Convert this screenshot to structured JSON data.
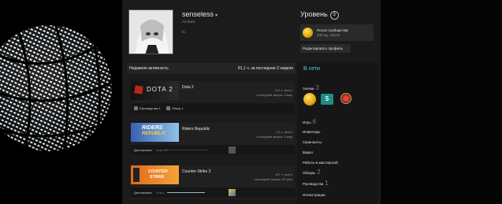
{
  "profile": {
    "name": "senseless",
    "status": "I'm tired",
    "summary": "fo."
  },
  "level": {
    "title": "Уровень",
    "value": "3"
  },
  "badge": {
    "name": "Посол сообщества",
    "xp": "200 ед. опыта"
  },
  "edit_profile": "Редактировать профиль",
  "online": "В сети",
  "right_links": [
    {
      "label": "Значки",
      "count": "3"
    },
    {
      "label": "Игры",
      "count": "6"
    },
    {
      "label": "Инвентарь",
      "count": ""
    },
    {
      "label": "Скриншоты",
      "count": ""
    },
    {
      "label": "Видео",
      "count": ""
    },
    {
      "label": "Работы в мастерской",
      "count": ""
    },
    {
      "label": "Обзоры",
      "count": "2"
    },
    {
      "label": "Руководства",
      "count": "1"
    },
    {
      "label": "Иллюстрации",
      "count": ""
    }
  ],
  "activity": {
    "title": "Недавняя активность",
    "hours": "81,1 ч. за последние 2 недели"
  },
  "games": [
    {
      "name": "Dota 2",
      "hours": "312 ч. всего",
      "last": "последний запуск: 4 мар",
      "tags": [
        "Руководства 1",
        "Обзор 1"
      ]
    },
    {
      "name": "Riders Republic",
      "hours": "1,5 ч. всего",
      "last": "последний запуск: 3 мар",
      "ach_label": "Достижения",
      "ach_value": "1 из 74",
      "ach_progress": 0.014
    },
    {
      "name": "Counter-Strike 2",
      "hours": "107 ч. всего",
      "last": "последний запуск: 29 фев",
      "ach_label": "Достижения",
      "ach_value": "1 из 1",
      "ach_progress": 1.0
    }
  ],
  "capsule_text": {
    "dota": "DOTA 2",
    "riders_1": "RIDERS",
    "riders_2": "REPUBLIC",
    "cs_1": "COUNTER",
    "cs_2": "STRIKE"
  },
  "colors": {
    "accent": "#57cbde",
    "page_bg": "#1b1b1b",
    "badge_gold": "#e0a400"
  }
}
